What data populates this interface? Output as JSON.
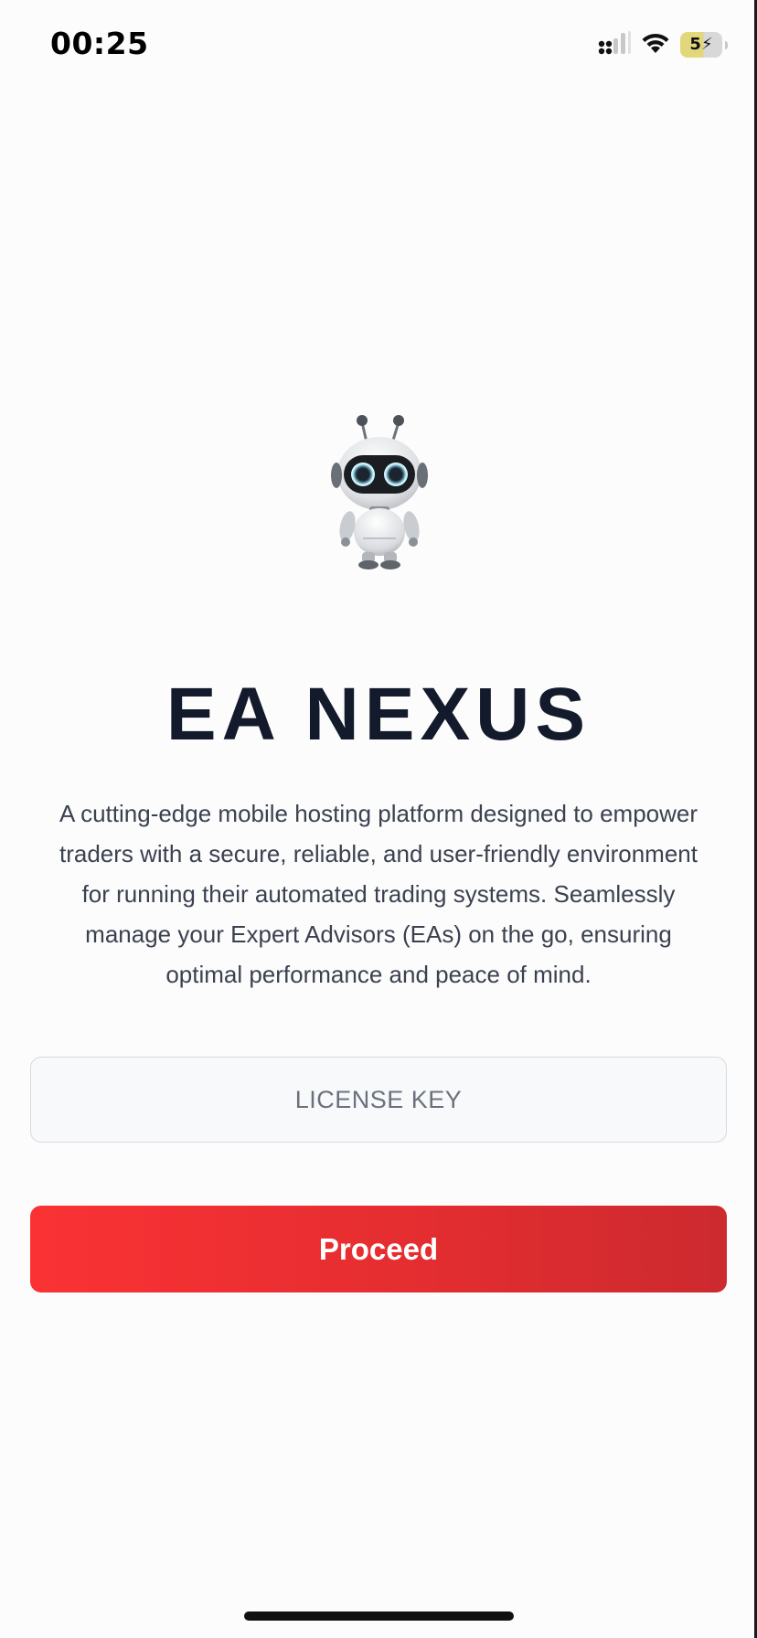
{
  "status_bar": {
    "time": "00:25",
    "battery_level": "5",
    "icons": [
      "cellular-signal-icon",
      "wifi-icon",
      "battery-charging-icon"
    ]
  },
  "app": {
    "title": "EA NEXUS",
    "description": "A cutting-edge mobile hosting platform designed to empower traders with a secure, reliable, and user-friendly environment for running their automated trading systems. Seamlessly manage your Expert Advisors (EAs) on the go, ensuring optimal performance and peace of mind.",
    "logo_icon": "robot-mascot-icon"
  },
  "form": {
    "license_key_placeholder": "LICENSE KEY",
    "license_key_value": "",
    "proceed_label": "Proceed"
  },
  "colors": {
    "title": "#121a2b",
    "button_gradient_start": "#fa3234",
    "button_gradient_end": "#cc2a2f",
    "input_background": "#f8f9fb",
    "input_border": "#d6d9df"
  }
}
